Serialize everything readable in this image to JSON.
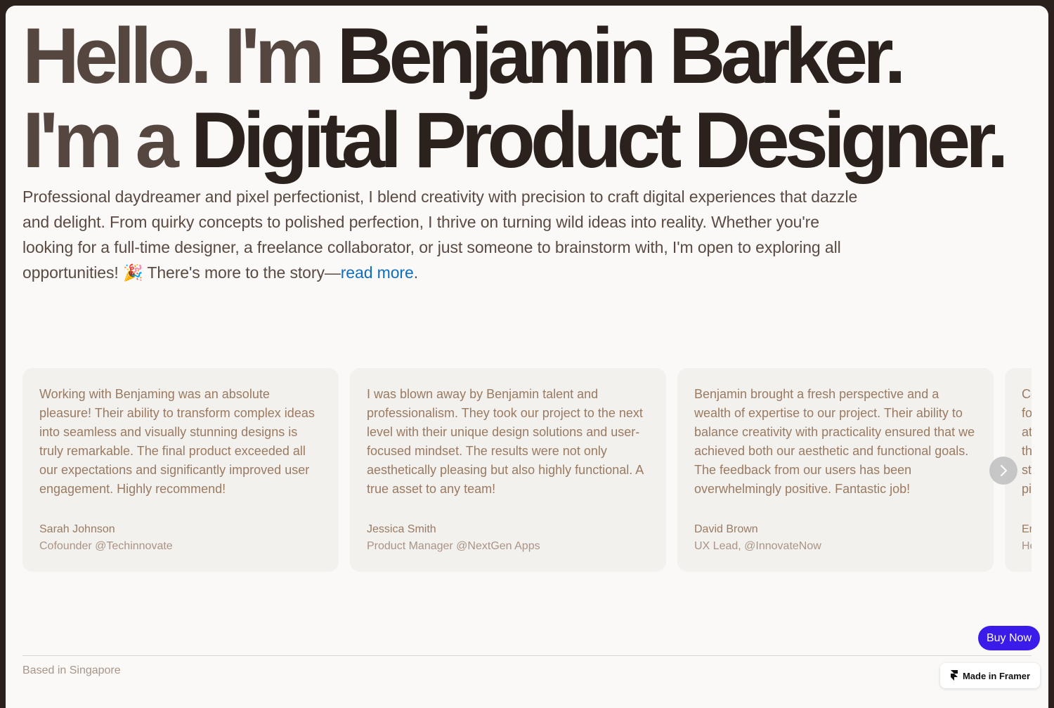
{
  "hero": {
    "line1_muted": "Hello. I'm ",
    "line1_bold": "Benjamin Barker.",
    "line2_muted": "I'm a ",
    "line2_bold": "Digital Product Designer."
  },
  "intro": {
    "text": "Professional daydreamer and pixel perfectionist, I blend creativity with precision to craft digital experiences that dazzle and delight. From quirky concepts to polished perfection, I thrive on turning wild ideas into reality. Whether you're looking for a full-time designer, a freelance collaborator, or just someone to brainstorm with, I'm open to exploring all opportunities! ",
    "emoji": "🎉",
    "story_lead": " There's more to the story—",
    "link_label": "read more",
    "trailing": "."
  },
  "testimonials": [
    {
      "quote": "Working with Benjaming was an absolute pleasure! Their ability to transform complex ideas into seamless and visually stunning designs is truly remarkable. The final product exceeded all our expectations and significantly improved user engagement. Highly recommend!",
      "name": "Sarah Johnson",
      "role": "Cofounder @Techinnovate"
    },
    {
      "quote": "I was blown away by Benjamin talent and professionalism. They took our project to the next level with their unique design solutions and user-focused mindset. The results were not only aesthetically pleasing but also highly functional. A true asset to any team!",
      "name": "Jessica Smith",
      "role": "Product Manager @NextGen Apps"
    },
    {
      "quote": "Benjamin brought a fresh perspective and a wealth of expertise to our project. Their ability to balance creativity with practicality ensured that we achieved both our aesthetic and functional goals. The feedback from our users has been overwhelmingly positive. Fantastic job!",
      "name": "David Brown",
      "role": "UX Lead, @InnovateNow"
    },
    {
      "quote": "Co fo at th st pi",
      "name": "Er",
      "role": "He"
    }
  ],
  "carousel": {
    "next_icon": "chevron-right-icon"
  },
  "footer": {
    "location": "Based in Singapore",
    "buy_label": "Buy Now",
    "framer_label": "Made in Framer",
    "framer_icon": "framer-logo-icon"
  },
  "colors": {
    "background": "#faf9f7",
    "frame": "#2a201c",
    "heading_dark": "#2b211d",
    "heading_muted": "#564640",
    "link": "#0f6fbf",
    "card_bg": "#f3f1ee",
    "card_text": "#9a7a61",
    "buy_button": "#3a1bea"
  }
}
